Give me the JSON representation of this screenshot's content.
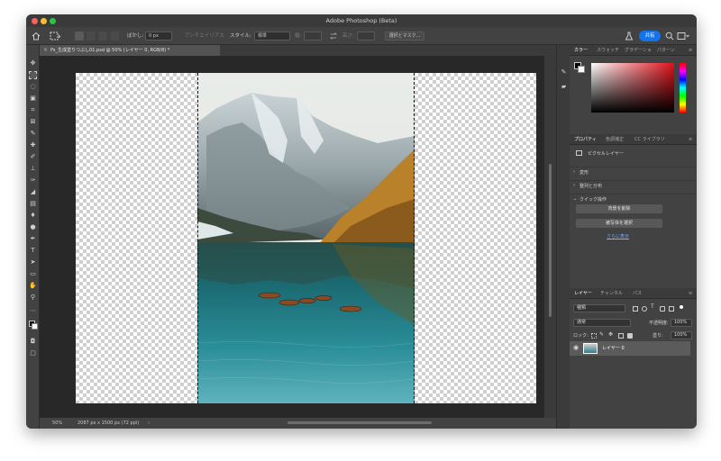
{
  "window": {
    "title": "Adobe Photoshop (Beta)"
  },
  "colors": {
    "accent": "#1473e6",
    "close": "#ff5f57",
    "minimize": "#febc2e",
    "zoom": "#28c840",
    "ui_dark": "#535353"
  },
  "options_bar": {
    "feather_label": "ぼかし:",
    "feather_value": "0 px",
    "antialias_label": "アンチエイリアス",
    "style_label": "スタイル:",
    "style_value": "標準",
    "width_label": "幅:",
    "height_label": "高さ:",
    "select_mask_label": "選択とマスク...",
    "share_label": "共有"
  },
  "document_tab": {
    "label": "Ps_生成塗りつぶし01.psd @ 50% (レイヤー 0, RGB/8) *"
  },
  "status_bar": {
    "zoom": "50%",
    "doc_info": "2087 px x 1500 px (72 ppi)"
  },
  "color_panel": {
    "tabs": [
      "カラー",
      "スウォッチ",
      "グラデーショ",
      "パターン"
    ]
  },
  "properties_panel": {
    "tabs": [
      "プロパティ",
      "色調補正",
      "CC ライブラリ"
    ],
    "layer_type": "ピクセルレイヤー",
    "sections": {
      "transform": "変形",
      "align": "整列と分布",
      "quick_actions": "クイック操作"
    },
    "buttons": {
      "remove_bg": "背景を削除",
      "select_subject": "被写体を選択"
    },
    "show_more": "さらに表示"
  },
  "layers_panel": {
    "tabs": [
      "レイヤー",
      "チャンネル",
      "パス"
    ],
    "filter_kind": "種類",
    "blend_mode": "通常",
    "opacity_label": "不透明度:",
    "opacity_value": "100%",
    "lock_label": "ロック:",
    "fill_label": "塗り:",
    "fill_value": "100%",
    "layers": [
      {
        "name": "レイヤー 0",
        "visible": true
      }
    ]
  }
}
